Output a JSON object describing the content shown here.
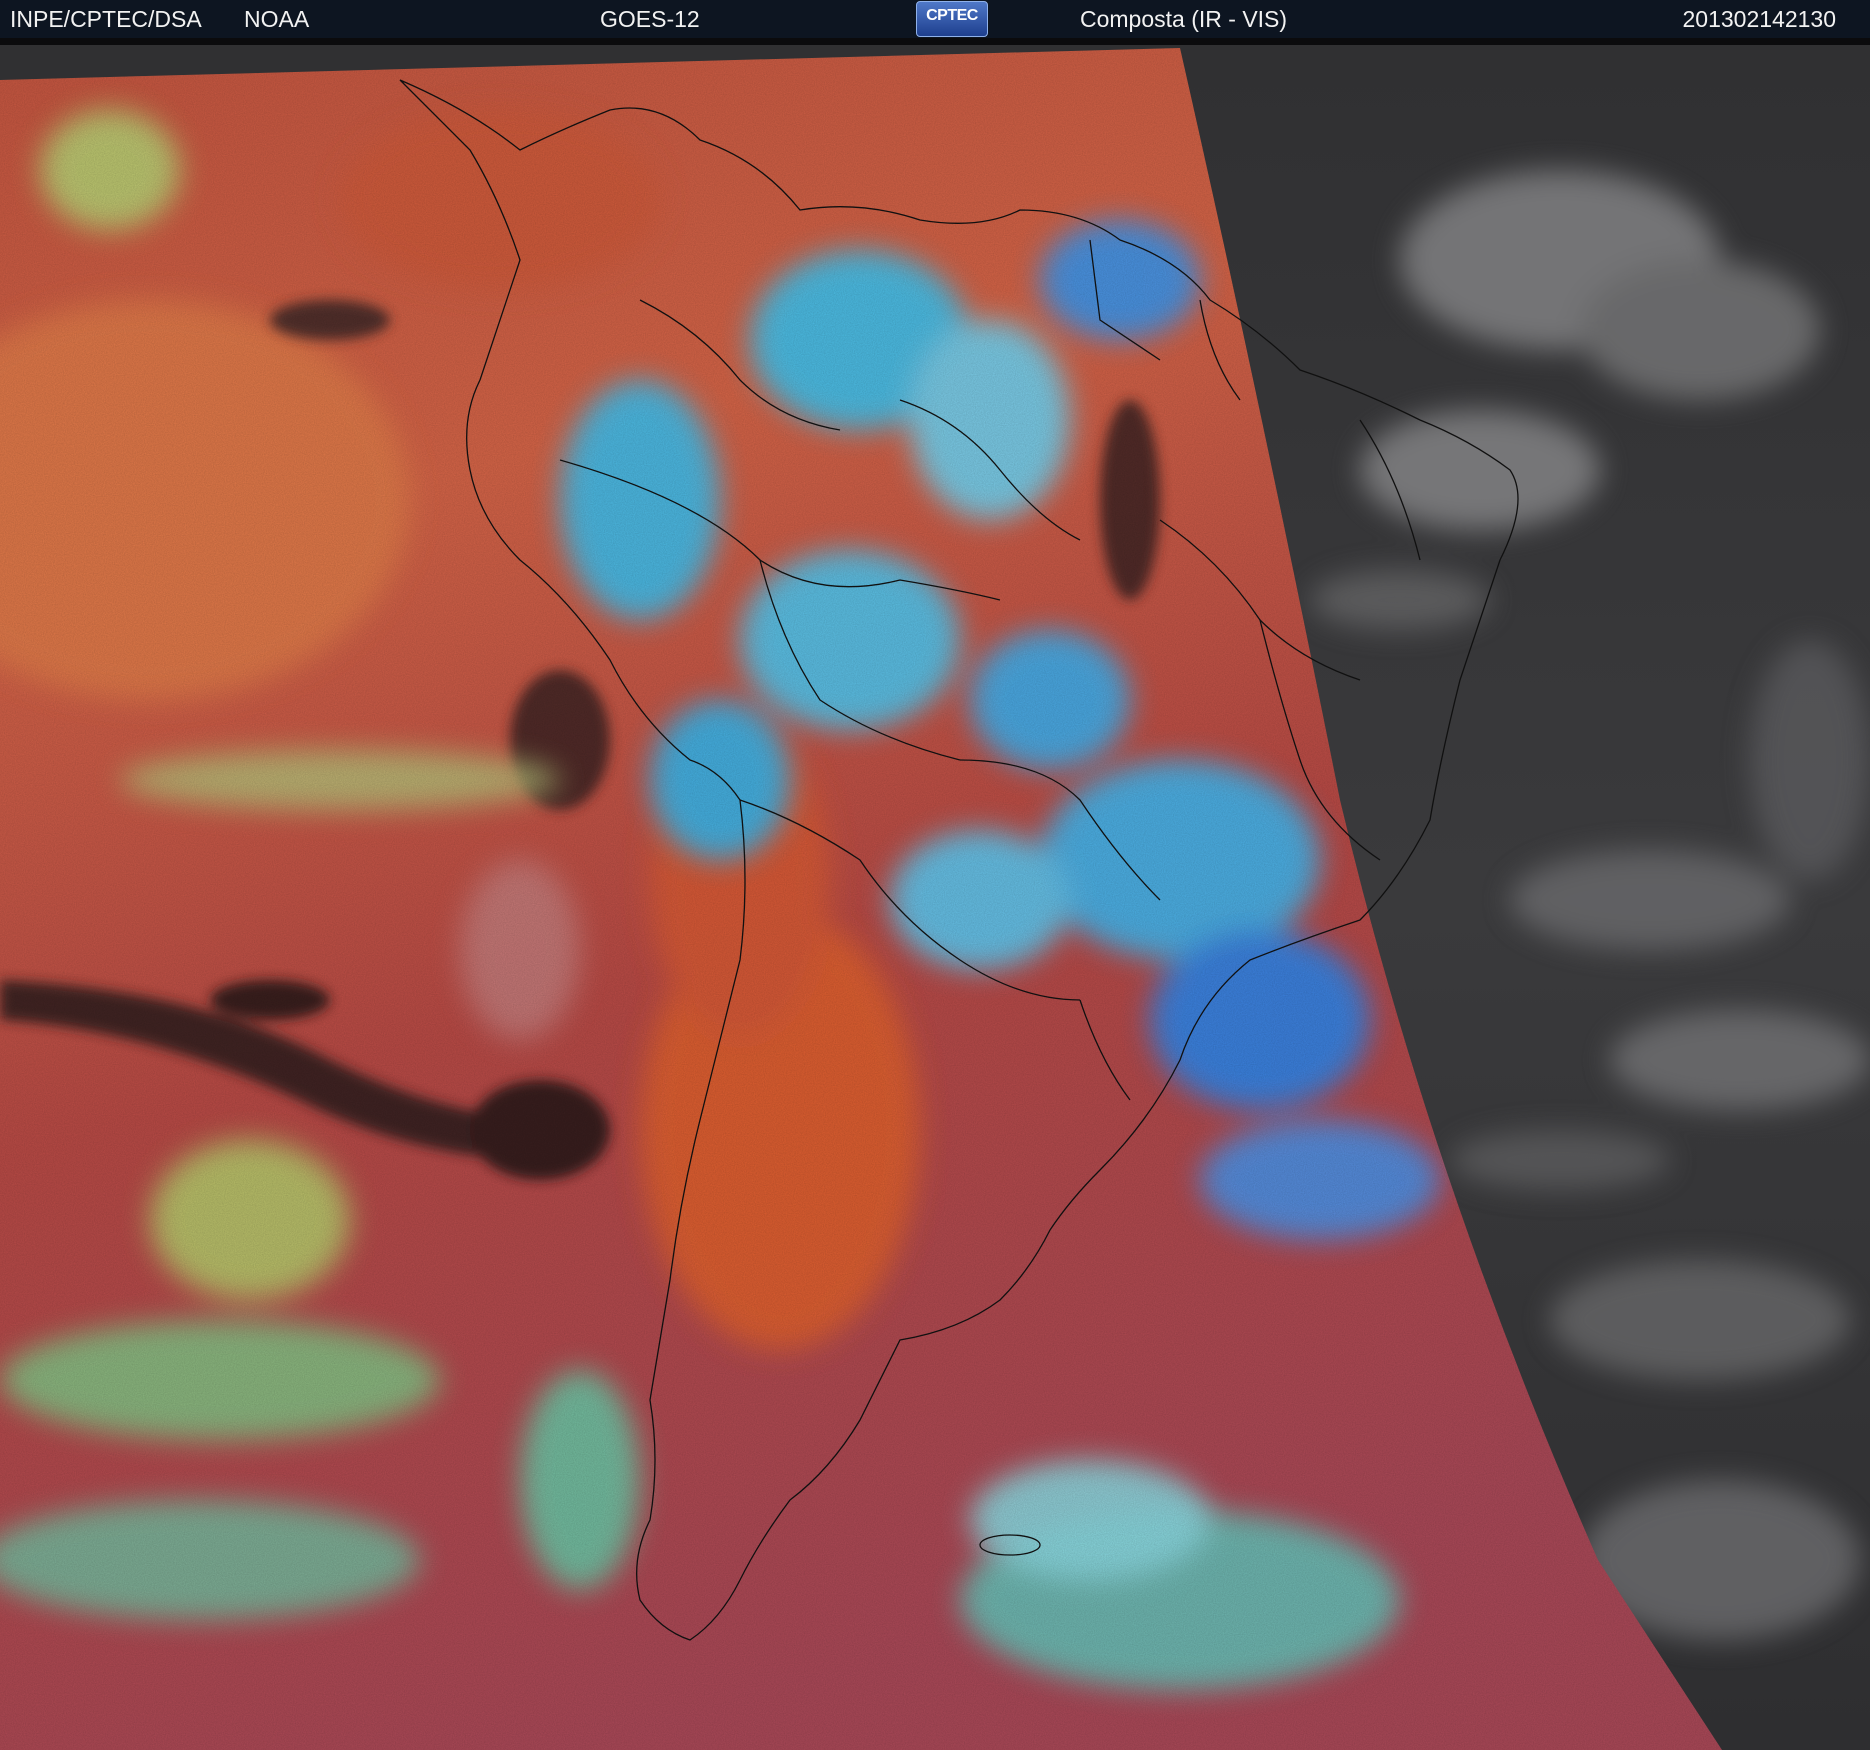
{
  "header": {
    "agency": "INPE/CPTEC/DSA",
    "source": "NOAA",
    "satellite": "GOES-12",
    "logo_text": "CPTEC",
    "product": "Composta (IR - VIS)",
    "timestamp": "201302142130"
  },
  "colors": {
    "header_bg": "#0d1521",
    "ocean_ir": "#c0503d",
    "high_cloud": "#34b9f0",
    "low_cloud": "#8fd68a",
    "cold_cloud_dark": "#2a1f1f",
    "visible_night": "#3a3a3c",
    "borders": "#111111"
  }
}
